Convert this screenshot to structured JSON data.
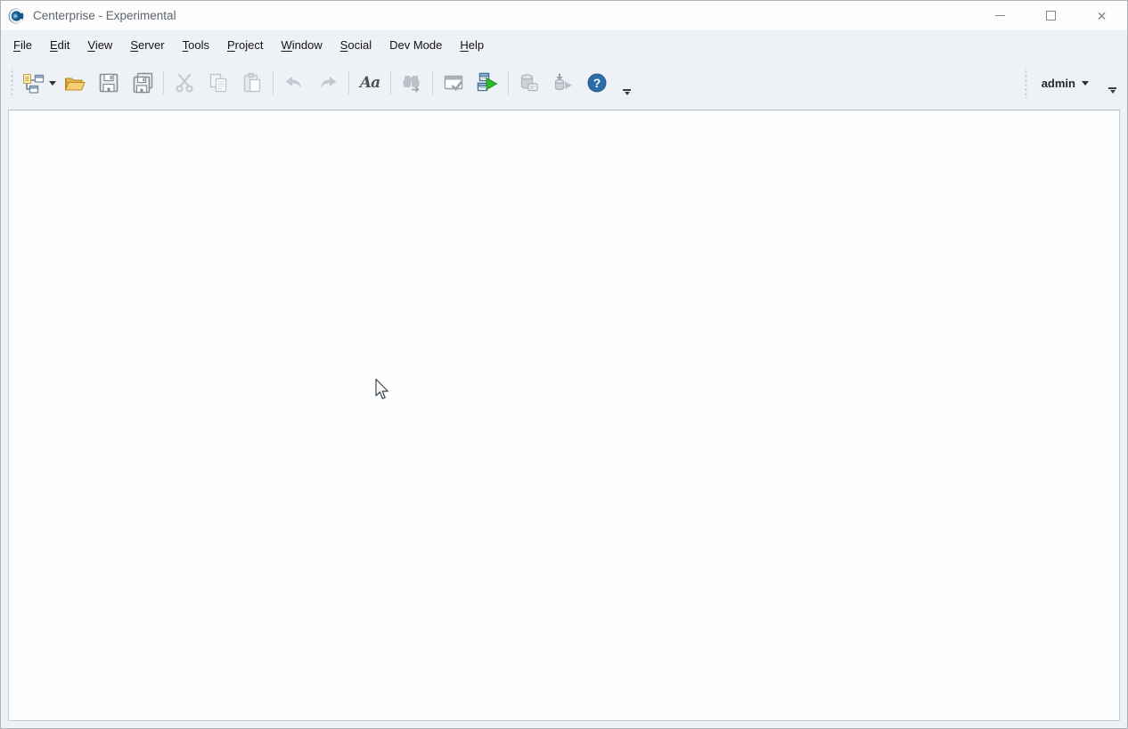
{
  "window": {
    "title": "Centerprise - Experimental",
    "controls": {
      "minimize": "minimize",
      "maximize": "maximize",
      "close": "✕"
    }
  },
  "menu": {
    "items": [
      {
        "label": "File",
        "mnemonic": "F",
        "rest": "ile"
      },
      {
        "label": "Edit",
        "mnemonic": "E",
        "rest": "dit"
      },
      {
        "label": "View",
        "mnemonic": "V",
        "rest": "iew"
      },
      {
        "label": "Server",
        "mnemonic": "S",
        "rest": "erver"
      },
      {
        "label": "Tools",
        "mnemonic": "T",
        "rest": "ools"
      },
      {
        "label": "Project",
        "mnemonic": "P",
        "rest": "roject"
      },
      {
        "label": "Window",
        "mnemonic": "W",
        "rest": "indow"
      },
      {
        "label": "Social",
        "mnemonic": "S",
        "rest": "ocial"
      },
      {
        "label": "Dev Mode",
        "mnemonic": "",
        "rest": "Dev Mode"
      },
      {
        "label": "Help",
        "mnemonic": "H",
        "rest": "elp"
      }
    ]
  },
  "toolbar": {
    "font_button_glyph": "Aa",
    "help_glyph": "?",
    "user_menu": {
      "label": "admin"
    },
    "buttons": [
      {
        "name": "new-dataflow-dropdown",
        "icon": "new-dataflow-icon",
        "enabled": true
      },
      {
        "name": "open",
        "icon": "open-folder-icon",
        "enabled": true
      },
      {
        "name": "save",
        "icon": "save-icon",
        "enabled": true
      },
      {
        "name": "save-all",
        "icon": "save-all-icon",
        "enabled": true
      },
      {
        "name": "cut",
        "icon": "scissors-icon",
        "enabled": false
      },
      {
        "name": "copy",
        "icon": "copy-icon",
        "enabled": false
      },
      {
        "name": "paste",
        "icon": "paste-icon",
        "enabled": false
      },
      {
        "name": "undo",
        "icon": "undo-arrow-icon",
        "enabled": false
      },
      {
        "name": "redo",
        "icon": "redo-arrow-icon",
        "enabled": false
      },
      {
        "name": "font",
        "icon": "font-aa-icon",
        "enabled": true
      },
      {
        "name": "find-replace",
        "icon": "binoculars-icon",
        "enabled": false
      },
      {
        "name": "verify",
        "icon": "verify-window-icon",
        "enabled": true
      },
      {
        "name": "run-dataflow",
        "icon": "run-dataflow-icon",
        "enabled": true
      },
      {
        "name": "database-job",
        "icon": "database-note-icon",
        "enabled": false
      },
      {
        "name": "deploy",
        "icon": "deploy-icon",
        "enabled": false
      },
      {
        "name": "help",
        "icon": "help-circle-icon",
        "enabled": true
      }
    ]
  },
  "colors": {
    "app_background": "#eef1f5",
    "titlebar_background": "#fdfdfe",
    "content_background": "#fdfeff",
    "accent_blue": "#2d6ca6",
    "folder_orange": "#f3c252",
    "run_green": "#2eb82e",
    "disabled_gray": "#c0c6cd"
  }
}
